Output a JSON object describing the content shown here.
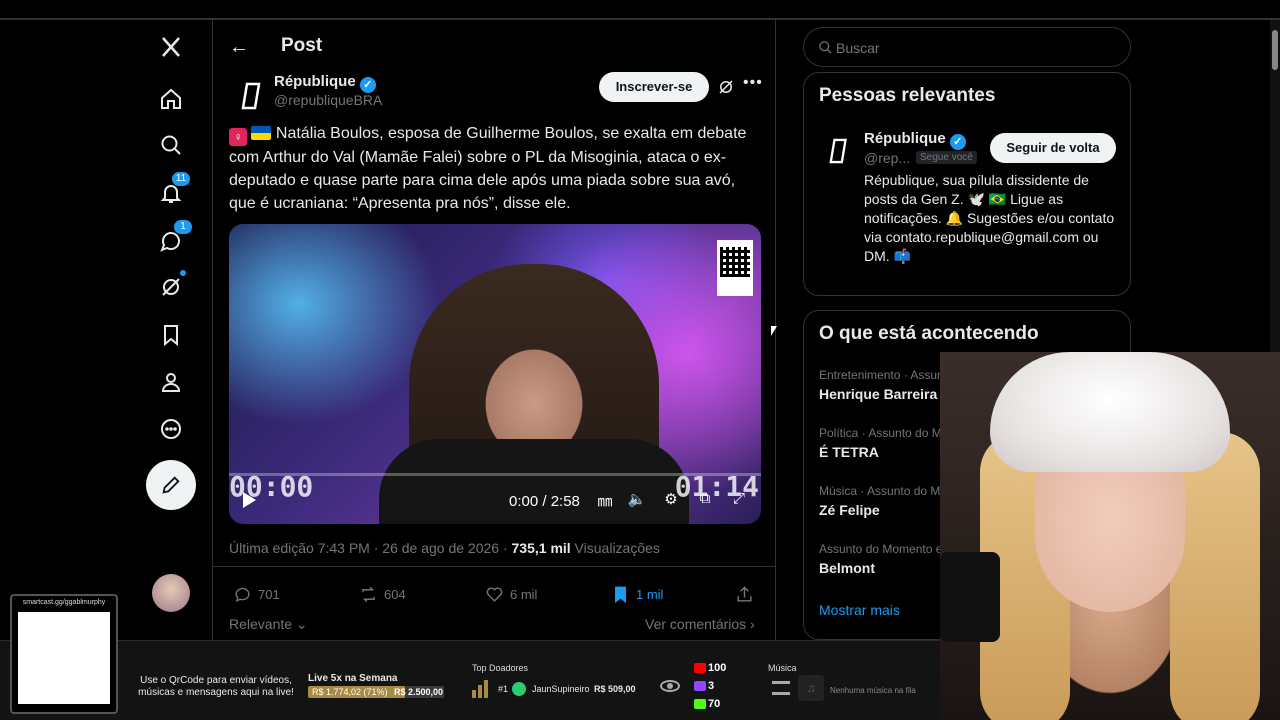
{
  "nav": {
    "notifications_badge": "11",
    "messages_badge": "1"
  },
  "header": {
    "title": "Post"
  },
  "post": {
    "author_name": "République",
    "author_handle": "@republiqueBRA",
    "subscribe_label": "Inscrever-se",
    "text": "Natália Boulos, esposa de Guilherme Boulos, se exalta em debate com Arthur do Val (Mamãe Falei) sobre o PL da Misoginia, ataca o ex-deputado e quase parte para cima dele após uma piada sobre sua avó, que é ucraniana: “Apresenta pra nós”, disse ele.",
    "video": {
      "overlay_left": "00:00",
      "overlay_right": "01:14",
      "time": "0:00 / 2:58",
      "progress": 0.0
    },
    "meta_edited": "Última edição 7:43 PM · 26 de ago de 2026 · ",
    "meta_views_count": "735,1 mil",
    "meta_views_label": " Visualizações",
    "replies": "701",
    "reposts": "604",
    "likes": "6 mil",
    "bookmarks": "1 mil",
    "sort_label": "Relevante",
    "comments_label": "Ver comentários"
  },
  "search": {
    "placeholder": "Buscar"
  },
  "relevant": {
    "title": "Pessoas relevantes",
    "name": "République",
    "handle": "@rep...",
    "follows_you": "Segue você",
    "follow_label": "Seguir de volta",
    "bio": "République, sua pílula dissidente de posts da Gen Z. 🕊️ 🇧🇷 Ligue as notificações. 🔔 Sugestões e/ou contato via contato.republique@gmail.com ou DM. 📫"
  },
  "trends": {
    "title": "O que está acontecendo",
    "items": [
      {
        "category": "Entretenimento · Assunto do Mome",
        "name": "Henrique Barreira"
      },
      {
        "category": "Política · Assunto do Momento",
        "name": "É TETRA"
      },
      {
        "category": "Música · Assunto do Momento",
        "name": "Zé Felipe"
      },
      {
        "category": "Assunto do Momento em Brasil",
        "name": "Belmont"
      }
    ],
    "show_more": "Mostrar mais"
  },
  "stream": {
    "qr_url": "smartcast.gg/ggablmurphy",
    "qr_text": "Use o QrCode para enviar vídeos, músicas e mensagens aqui na live!",
    "goal_title": "Live 5x na Semana",
    "goal_current": "R$ 1.774,02 (71%)",
    "goal_total": "R$ 2.500,00",
    "goal_fraction": 0.71,
    "donors_title": "Top Doadores",
    "donor_rank": "#1",
    "donor_name": "JaunSupineiro",
    "donor_amount": "R$ 509,00",
    "youtube_count": "100",
    "twitch_count": "3",
    "kick_count": "70",
    "music_title": "Música",
    "music_now": "Nenhuma música na fila"
  },
  "colors": {
    "accent": "#1d9bf0",
    "background": "#000000",
    "border": "#2f3336",
    "muted_text": "#71767b",
    "youtube": "#ff0000",
    "twitch": "#9146ff",
    "kick": "#53fc18"
  }
}
